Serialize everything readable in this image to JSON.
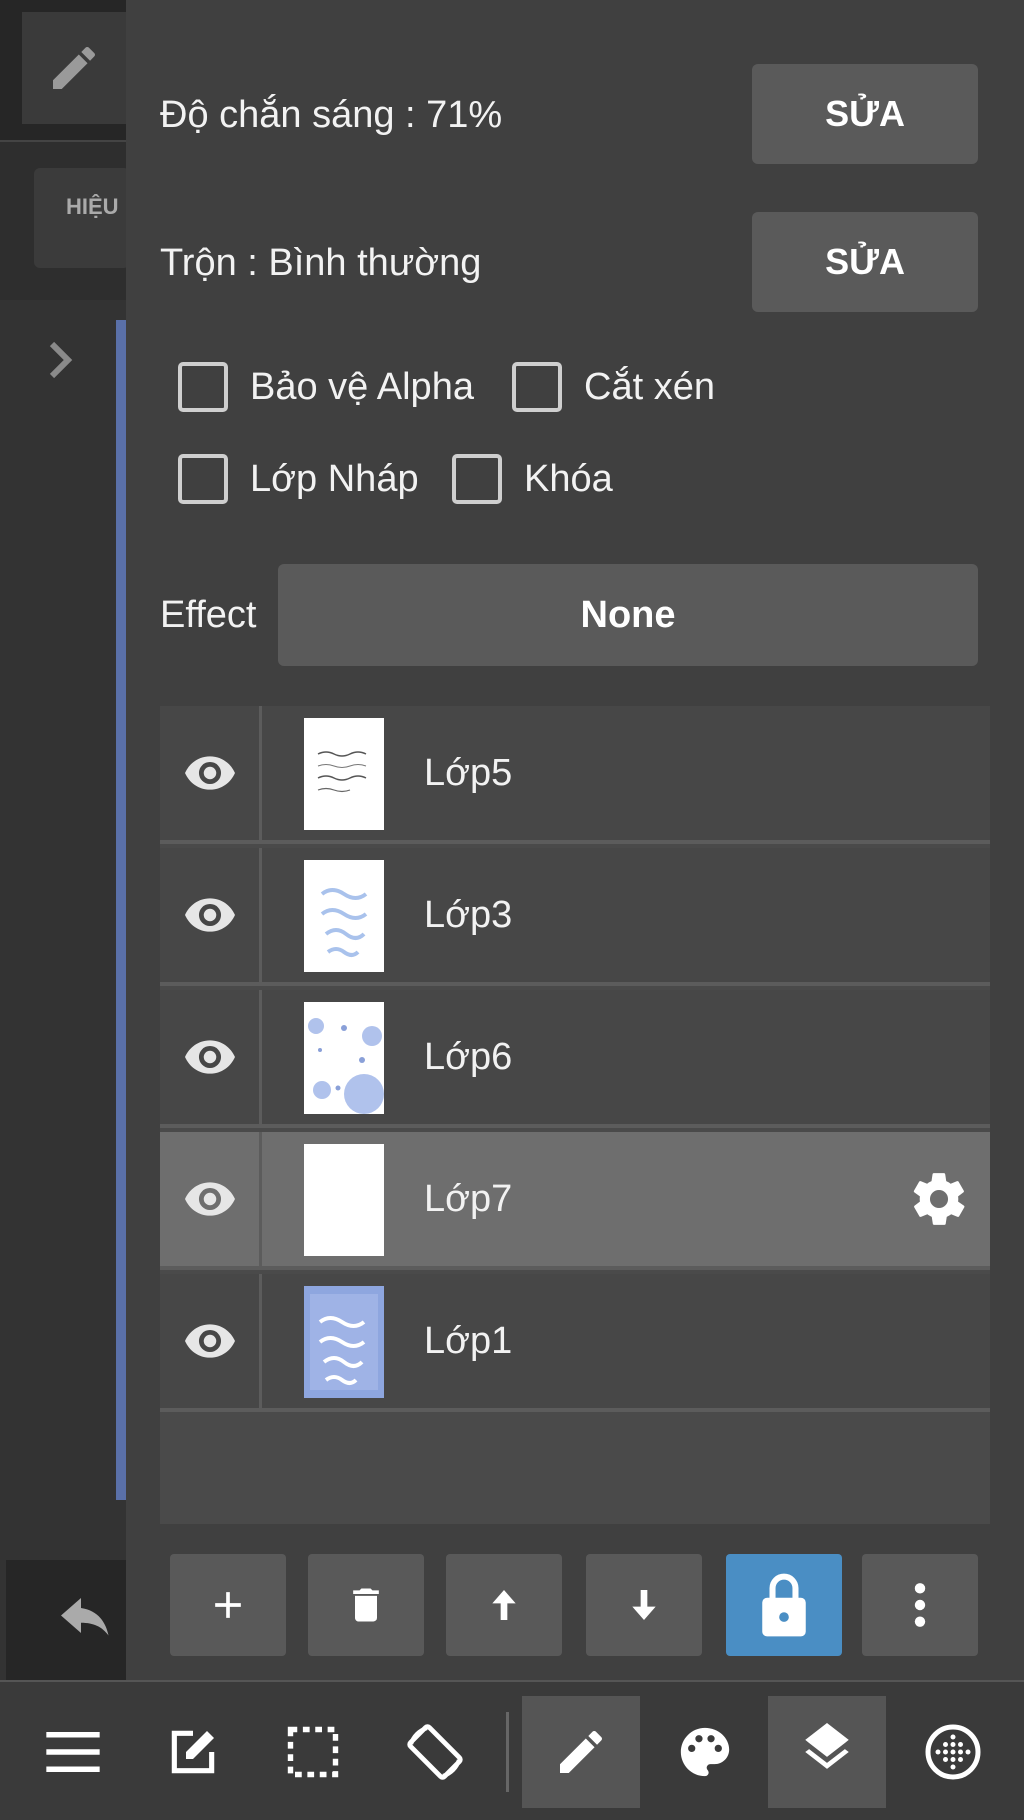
{
  "background": {
    "effect_tab": "HIỆU"
  },
  "properties": {
    "opacity_label": "Độ chắn sáng : 71%",
    "opacity_edit": "SỬA",
    "blend_label": "Trộn : Bình thường",
    "blend_edit": "SỬA",
    "checkboxes": {
      "alpha_protect": "Bảo vệ Alpha",
      "clipping": "Cắt xén",
      "draft_layer": "Lớp Nháp",
      "lock": "Khóa"
    },
    "effect_label": "Effect",
    "effect_value": "None"
  },
  "layers": [
    {
      "name": "Lớp5",
      "selected": false
    },
    {
      "name": "Lớp3",
      "selected": false
    },
    {
      "name": "Lớp6",
      "selected": false
    },
    {
      "name": "Lớp7",
      "selected": true
    },
    {
      "name": "Lớp1",
      "selected": false
    }
  ],
  "actions": [
    "add-icon",
    "trash-icon",
    "arrow-up-icon",
    "arrow-down-icon",
    "lock-icon",
    "more-vertical-icon"
  ],
  "toolbar": [
    "menu-icon",
    "edit-canvas-icon",
    "selection-icon",
    "rotate-icon",
    "pencil-icon",
    "palette-icon",
    "layers-icon",
    "grid-icon"
  ],
  "colors": {
    "accent": "#4a8ec4",
    "panel": "#404040",
    "button": "#5a5a5a"
  }
}
